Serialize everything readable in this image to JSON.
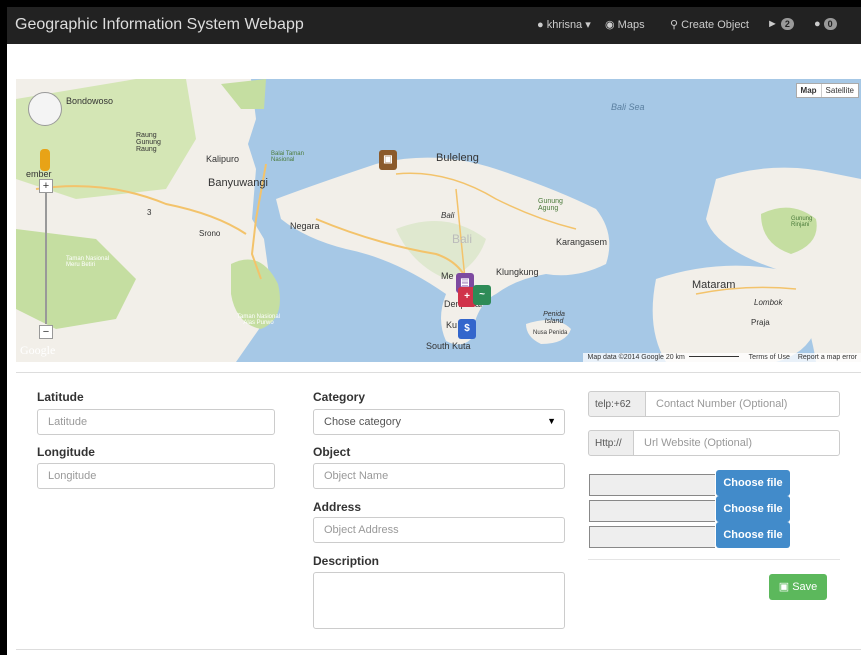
{
  "app": {
    "title": "Geographic Information System Webapp"
  },
  "nav": {
    "user": "khrisna",
    "maps": "Maps",
    "create": "Create Object",
    "tag_count": "2",
    "user_count": "0"
  },
  "map": {
    "type_map": "Map",
    "type_satellite": "Satellite",
    "google": "Google",
    "attribution": "Map data ©2014 Google",
    "scale": "20 km",
    "terms": "Terms of Use",
    "report": "Report a map error",
    "labels": {
      "bondowoso": "Bondowoso",
      "raung": "Raung Gunung Raung",
      "jember": "ember",
      "kalipuro": "Kalipuro",
      "baluran": "Balai Taman Nasional",
      "banyuwangi": "Banyuwangi",
      "srono": "Srono",
      "meru": "Taman Nasional Meru Betiri",
      "alas": "Taman Nasional Alas Purwo",
      "buleleng": "Buleleng",
      "bali_sea": "Bali Sea",
      "negara": "Negara",
      "bali1": "Bali",
      "bali2": "Bali",
      "agung": "Gunung Agung",
      "karangasem": "Karangasem",
      "klungkung": "Klungkung",
      "mengwi": "Me",
      "denpasar": "Denpasar",
      "kuta": "Ku",
      "south_kuta": "South Kuta",
      "penida": "Penida Island",
      "nusa_penida": "Nusa Penida",
      "mataram": "Mataram",
      "lombok": "Lombok",
      "praja": "Praja",
      "rinjani": "Gunung Rinjani"
    },
    "route_3": "3"
  },
  "form": {
    "latitude_label": "Latitude",
    "latitude_placeholder": "Latitude",
    "longitude_label": "Longitude",
    "longitude_placeholder": "Longitude",
    "category_label": "Category",
    "category_value": "Chose category",
    "object_label": "Object",
    "object_placeholder": "Object Name",
    "address_label": "Address",
    "address_placeholder": "Object Address",
    "description_label": "Description",
    "telp_addon": "telp:+62",
    "contact_placeholder": "Contact Number (Optional)",
    "http_addon": "Http://",
    "url_placeholder": "Url Website (Optional)",
    "choose_file": "Choose file",
    "save": "Save"
  },
  "colors": {
    "navbar": "#222222",
    "primary": "#428bca",
    "success": "#5cb85c",
    "water": "#a6c8e6",
    "land": "#f2efe9",
    "park": "#c5dea1"
  }
}
